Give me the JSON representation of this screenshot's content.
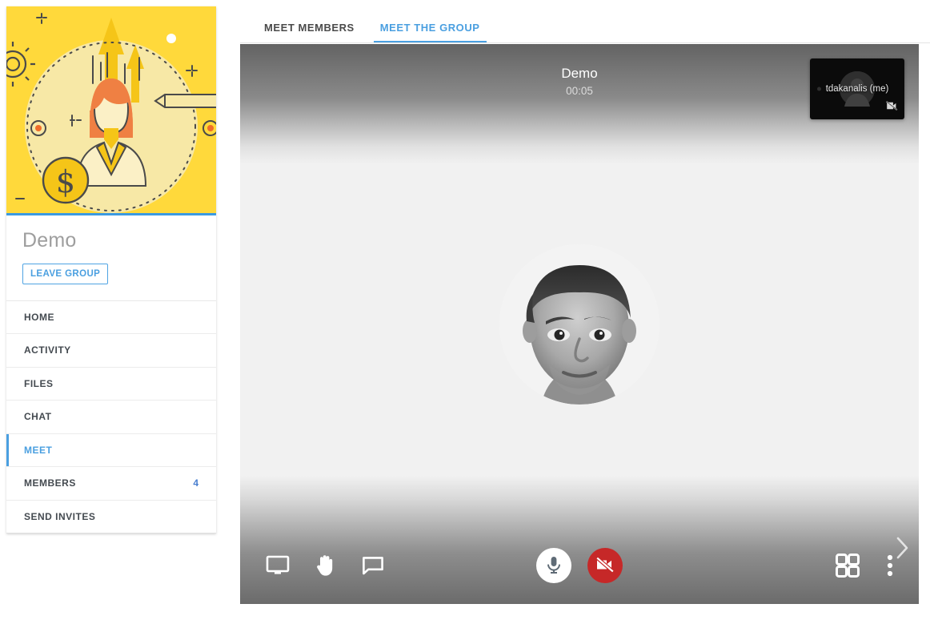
{
  "sidebar": {
    "cover_alt": "group-cover-illustration",
    "group_name": "Demo",
    "leave_label": "LEAVE GROUP",
    "nav": [
      {
        "label": "HOME",
        "badge": "",
        "active": false,
        "name": "home"
      },
      {
        "label": "ACTIVITY",
        "badge": "",
        "active": false,
        "name": "activity"
      },
      {
        "label": "FILES",
        "badge": "",
        "active": false,
        "name": "files"
      },
      {
        "label": "CHAT",
        "badge": "",
        "active": false,
        "name": "chat"
      },
      {
        "label": "MEET",
        "badge": "",
        "active": true,
        "name": "meet"
      },
      {
        "label": "MEMBERS",
        "badge": "4",
        "active": false,
        "name": "members"
      },
      {
        "label": "SEND INVITES",
        "badge": "",
        "active": false,
        "name": "send-invites"
      }
    ]
  },
  "tabs": [
    {
      "label": "MEET MEMBERS",
      "active": false
    },
    {
      "label": "MEET THE GROUP",
      "active": true
    }
  ],
  "meeting": {
    "name": "Demo",
    "timer": "00:05",
    "self_view": {
      "name": "tdakanalis (me)",
      "camera_off_icon": "videocam-off-icon"
    },
    "speaker_avatar": "participant-portrait"
  },
  "controls": {
    "left": [
      {
        "name": "screen-share-icon",
        "label": "Share screen"
      },
      {
        "name": "raise-hand-icon",
        "label": "Raise hand"
      },
      {
        "name": "chat-icon",
        "label": "Chat"
      }
    ],
    "center": [
      {
        "name": "microphone-icon",
        "label": "Microphone"
      },
      {
        "name": "videocam-off-icon",
        "label": "Camera off"
      }
    ],
    "right": [
      {
        "name": "grid-view-icon",
        "label": "Tile view"
      },
      {
        "name": "more-options-icon",
        "label": "More options"
      }
    ],
    "next_arrow": "chevron-right-icon"
  },
  "colors": {
    "accent_blue": "#4a9fe0",
    "cover_yellow": "#ffd93b",
    "camera_off_red": "#c62828",
    "stage_bg": "#f1f1f1",
    "title_gray": "#9e9e9e"
  }
}
